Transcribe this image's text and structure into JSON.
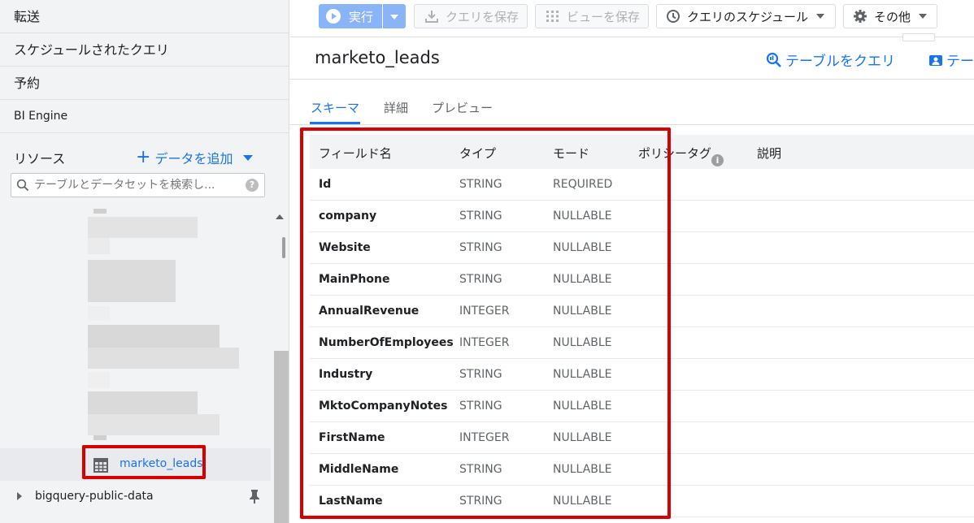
{
  "sidebar": {
    "nav_items": [
      "転送",
      "スケジュールされたクエリ",
      "予約",
      "BI Engine"
    ],
    "resources_label": "リソース",
    "add_data_label": "データを追加",
    "search": {
      "placeholder": "テーブルとデータセットを検索し..."
    },
    "selected_table": "marketo_leads",
    "public_project": "bigquery-public-data"
  },
  "toolbar": {
    "run_label": "実行",
    "save_query_label": "クエリを保存",
    "save_view_label": "ビューを保存",
    "schedule_label": "クエリのスケジュール",
    "more_label": "その他"
  },
  "header": {
    "title": "marketo_leads",
    "query_table_label": "テーブルをクエリ",
    "share_label": "テー"
  },
  "tabs": [
    "スキーマ",
    "詳細",
    "プレビュー"
  ],
  "schema": {
    "columns": [
      "フィールド名",
      "タイプ",
      "モード",
      "ポリシータグ",
      "説明"
    ],
    "rows": [
      {
        "name": "Id",
        "type": "STRING",
        "mode": "REQUIRED"
      },
      {
        "name": "company",
        "type": "STRING",
        "mode": "NULLABLE"
      },
      {
        "name": "Website",
        "type": "STRING",
        "mode": "NULLABLE"
      },
      {
        "name": "MainPhone",
        "type": "STRING",
        "mode": "NULLABLE"
      },
      {
        "name": "AnnualRevenue",
        "type": "INTEGER",
        "mode": "NULLABLE"
      },
      {
        "name": "NumberOfEmployees",
        "type": "INTEGER",
        "mode": "NULLABLE"
      },
      {
        "name": "Industry",
        "type": "STRING",
        "mode": "NULLABLE"
      },
      {
        "name": "MktoCompanyNotes",
        "type": "STRING",
        "mode": "NULLABLE"
      },
      {
        "name": "FirstName",
        "type": "INTEGER",
        "mode": "NULLABLE"
      },
      {
        "name": "MiddleName",
        "type": "STRING",
        "mode": "NULLABLE"
      },
      {
        "name": "LastName",
        "type": "STRING",
        "mode": "NULLABLE"
      }
    ]
  },
  "colors": {
    "accent": "#1a73e8",
    "highlight": "#d50000",
    "run_button": "#8ab4f8"
  }
}
